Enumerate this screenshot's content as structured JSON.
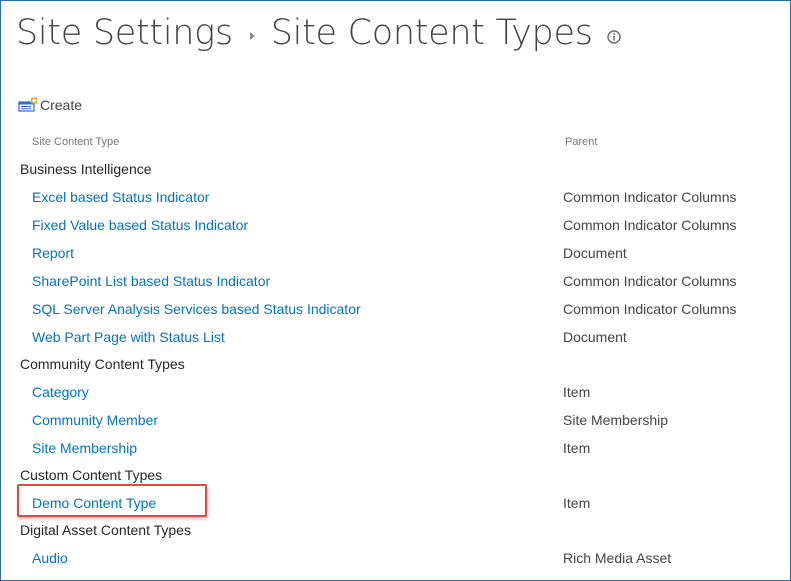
{
  "breadcrumb": {
    "parent": "Site Settings",
    "current": "Site Content Types",
    "info_icon": "info-icon"
  },
  "toolbar": {
    "create_label": "Create",
    "create_icon": "new-content-type-icon"
  },
  "table": {
    "headers": {
      "type": "Site Content Type",
      "parent": "Parent"
    },
    "groups": [
      {
        "name": "Business Intelligence",
        "items": [
          {
            "name": "Excel based Status Indicator",
            "parent": "Common Indicator Columns"
          },
          {
            "name": "Fixed Value based Status Indicator",
            "parent": "Common Indicator Columns"
          },
          {
            "name": "Report",
            "parent": "Document"
          },
          {
            "name": "SharePoint List based Status Indicator",
            "parent": "Common Indicator Columns"
          },
          {
            "name": "SQL Server Analysis Services based Status Indicator",
            "parent": "Common Indicator Columns"
          },
          {
            "name": "Web Part Page with Status List",
            "parent": "Document"
          }
        ]
      },
      {
        "name": "Community Content Types",
        "items": [
          {
            "name": "Category",
            "parent": "Item"
          },
          {
            "name": "Community Member",
            "parent": "Site Membership"
          },
          {
            "name": "Site Membership",
            "parent": "Item"
          }
        ]
      },
      {
        "name": "Custom Content Types",
        "items": [
          {
            "name": "Demo Content Type",
            "parent": "Item"
          }
        ]
      },
      {
        "name": "Digital Asset Content Types",
        "items": [
          {
            "name": "Audio",
            "parent": "Rich Media Asset"
          }
        ]
      }
    ]
  },
  "colors": {
    "link": "#0072c6",
    "highlight": "#e04848",
    "frame": "#2b6cb0"
  }
}
